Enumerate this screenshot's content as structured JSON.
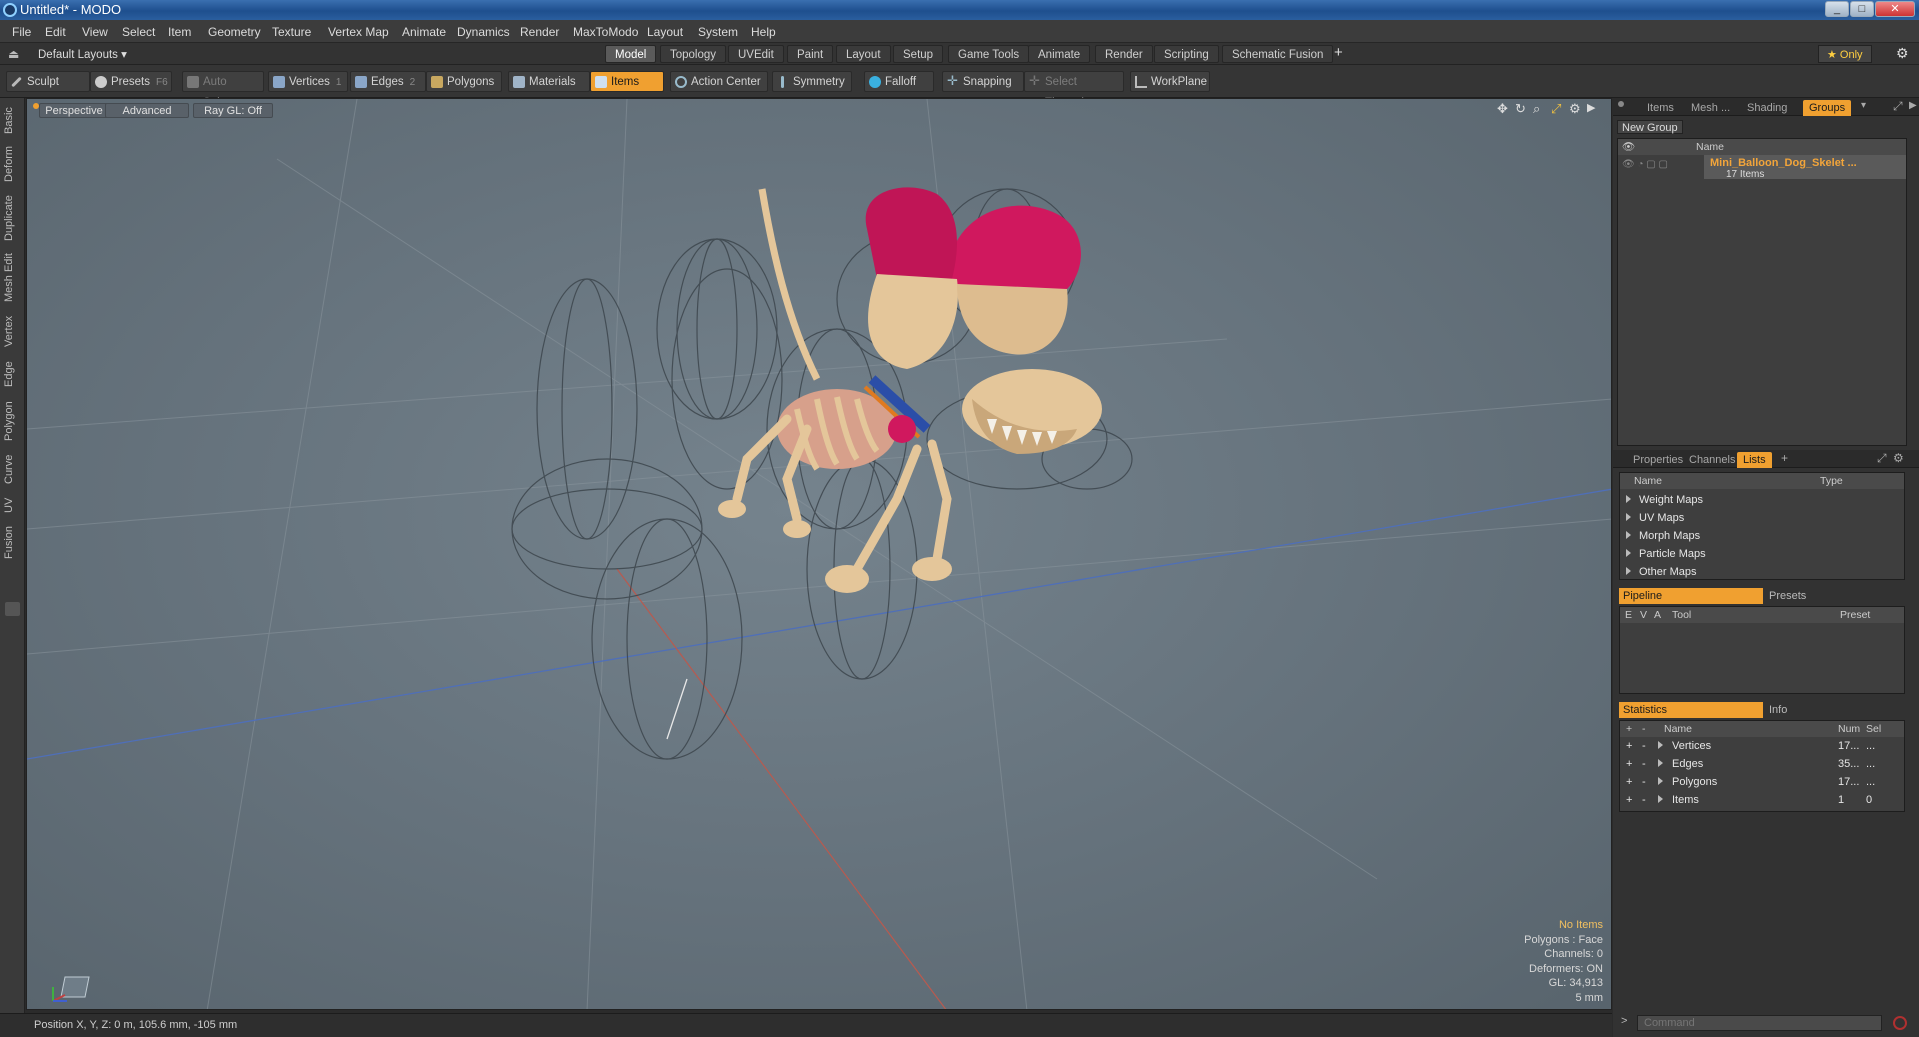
{
  "window": {
    "title": "Untitled* - MODO",
    "min": "_",
    "max": "□",
    "close": "✕"
  },
  "menu": [
    "File",
    "Edit",
    "View",
    "Select",
    "Item",
    "Geometry",
    "Texture",
    "Vertex Map",
    "Animate",
    "Dynamics",
    "Render",
    "MaxToModo",
    "Layout",
    "System",
    "Help"
  ],
  "layout_selector": "Default Layouts ▾",
  "layout_tabs": [
    "Model",
    "Topology",
    "UVEdit",
    "Paint",
    "Layout",
    "Setup",
    "Game Tools",
    "Animate",
    "Render",
    "Scripting",
    "Schematic Fusion"
  ],
  "active_layout_tab": "Model",
  "only_label": "★  Only",
  "toolbar": {
    "sculpt": "Sculpt",
    "presets": "Presets",
    "presets_key": "F6",
    "auto_select": "Auto Select",
    "vertices": "Vertices",
    "vertices_key": "1",
    "edges": "Edges",
    "edges_key": "2",
    "polygons": "Polygons",
    "materials": "Materials",
    "items": "Items",
    "action_center": "Action Center",
    "symmetry": "Symmetry",
    "falloff": "Falloff",
    "snapping": "Snapping",
    "select_through": "Select Through",
    "workplane": "WorkPlane"
  },
  "left_tabs": [
    "Basic",
    "Deform",
    "Duplicate",
    "Mesh Edit",
    "Vertex",
    "Edge",
    "Polygon",
    "Curve",
    "UV",
    "Fusion"
  ],
  "viewport": {
    "perspective": "Perspective",
    "advanced": "Advanced",
    "raygl": "Ray GL: Off",
    "stats": {
      "items": "No Items",
      "polygons": "Polygons : Face",
      "channels": "Channels: 0",
      "deformers": "Deformers: ON",
      "gl": "GL: 34,913",
      "unit": "5 mm"
    }
  },
  "status": {
    "position": "Position X, Y, Z:  0 m, 105.6 mm, -105 mm"
  },
  "groups_panel": {
    "tabs": [
      "Items",
      "Mesh ...",
      "Shading",
      "Groups"
    ],
    "new_group": "New Group",
    "name_col": "Name",
    "group_name": "Mini_Balloon_Dog_Skelet ...",
    "group_count": "17 Items"
  },
  "lists_panel": {
    "tabs": [
      "Properties",
      "Channels",
      "Lists"
    ],
    "name_col": "Name",
    "type_col": "Type",
    "items": [
      "Weight Maps",
      "UV Maps",
      "Morph Maps",
      "Particle Maps",
      "Other Maps"
    ]
  },
  "pipeline_panel": {
    "tab1": "Pipeline",
    "tab2": "Presets",
    "cols": [
      "E",
      "V",
      "A",
      "Tool",
      "Preset"
    ]
  },
  "stats_panel": {
    "tab1": "Statistics",
    "tab2": "Info",
    "name_col": "Name",
    "num_col": "Num",
    "sel_col": "Sel",
    "rows": [
      {
        "name": "Vertices",
        "num": "17...",
        "sel": "..."
      },
      {
        "name": "Edges",
        "num": "35...",
        "sel": "..."
      },
      {
        "name": "Polygons",
        "num": "17...",
        "sel": "..."
      },
      {
        "name": "Items",
        "num": "1",
        "sel": "0"
      }
    ]
  },
  "command": {
    "placeholder": "Command",
    "prompt": ">"
  },
  "colors": {
    "accent": "#f0a030",
    "viewport_bg": "#66737d",
    "balloon_pink": "#d0185e",
    "bone": "#e4c69a"
  }
}
